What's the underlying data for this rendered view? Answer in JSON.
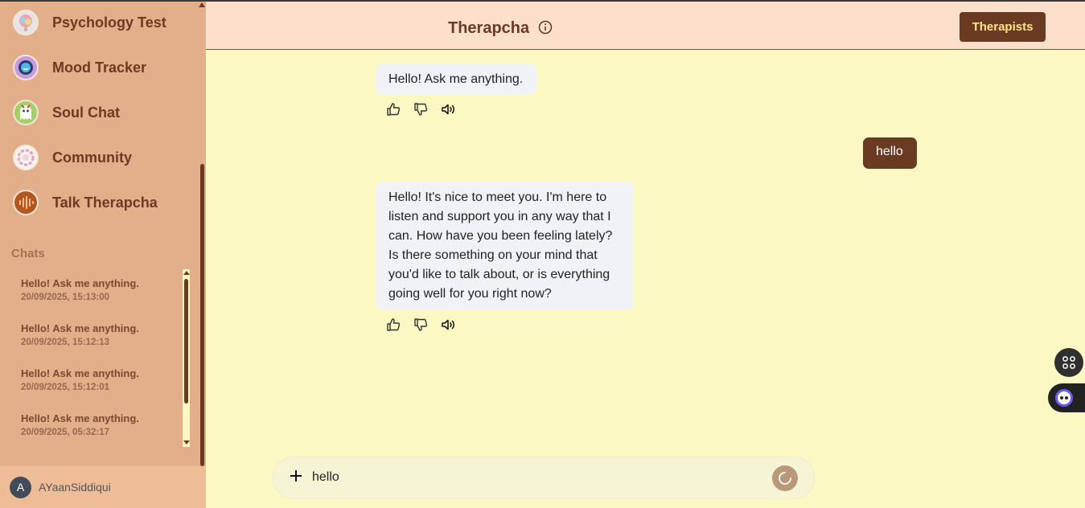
{
  "sidebar": {
    "nav_items": [
      {
        "label": "Psychology Test",
        "icon": "brain-icon"
      },
      {
        "label": "Mood Tracker",
        "icon": "mood-watch-icon"
      },
      {
        "label": "Soul Chat",
        "icon": "ghost-icon"
      },
      {
        "label": "Community",
        "icon": "community-circle-icon"
      },
      {
        "label": "Talk Therapcha",
        "icon": "soundwave-icon"
      }
    ],
    "chats_heading": "Chats",
    "chats": [
      {
        "title": "Hello! Ask me anything.",
        "time": "20/09/2025, 15:13:00"
      },
      {
        "title": "Hello! Ask me anything.",
        "time": "20/09/2025, 15:12:13"
      },
      {
        "title": "Hello! Ask me anything.",
        "time": "20/09/2025, 15:12:01"
      },
      {
        "title": "Hello! Ask me anything.",
        "time": "20/09/2025, 05:32:17"
      }
    ],
    "user": {
      "initial": "A",
      "name": "AYaanSiddiqui"
    }
  },
  "header": {
    "title": "Therapcha",
    "therapists_label": "Therapists"
  },
  "messages": [
    {
      "role": "bot",
      "text": "Hello! Ask me anything."
    },
    {
      "role": "user",
      "text": "hello"
    },
    {
      "role": "bot",
      "text": "Hello! It's nice to meet you. I'm here to listen and support you in any way that I can. How have you been feeling lately? Is there something on your mind that you'd like to talk about, or is everything going well for you right now?"
    }
  ],
  "composer": {
    "value": "hello"
  },
  "colors": {
    "accent": "#6b3a22",
    "sidebar": "#e3ae8a",
    "background": "#fbf8c4",
    "header": "#fde0cc"
  }
}
